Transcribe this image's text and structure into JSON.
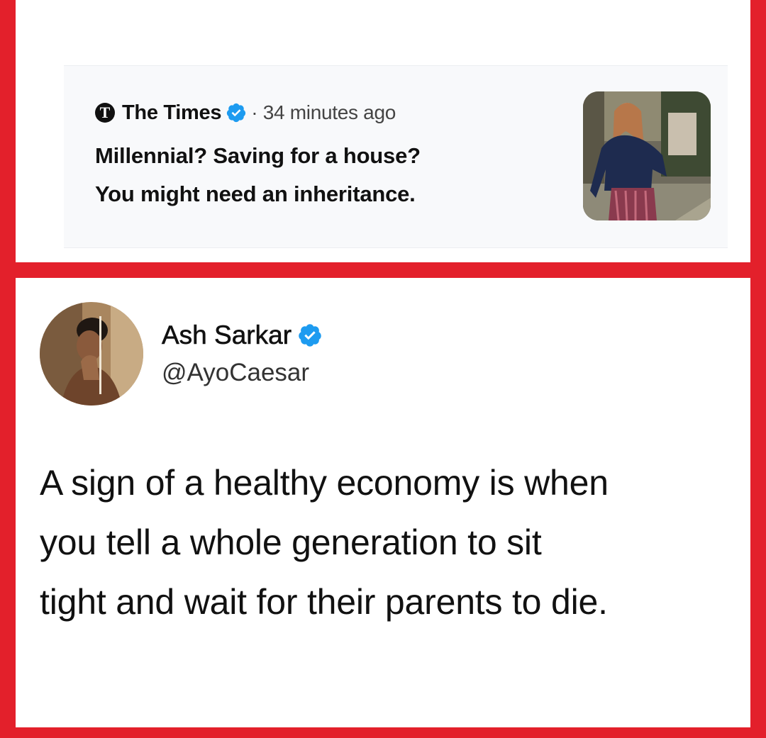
{
  "quoted_card": {
    "logo_letter": "T",
    "source": "The Times",
    "time": "· 34 minutes ago",
    "headline_line1": "Millennial? Saving for a house?",
    "headline_line2": "You might need an inheritance."
  },
  "tweet": {
    "author_name": "Ash Sarkar",
    "handle": "@AyoCaesar",
    "body_line1": "A sign of a healthy economy is when",
    "body_line2": "you tell a whole generation to sit",
    "body_line3": "tight and wait for their parents to die."
  },
  "icons": {
    "verified": "verified-badge-icon",
    "logo": "times-logo-icon"
  },
  "colors": {
    "frame": "#e3202b",
    "verified_blue": "#1d9bf0"
  }
}
